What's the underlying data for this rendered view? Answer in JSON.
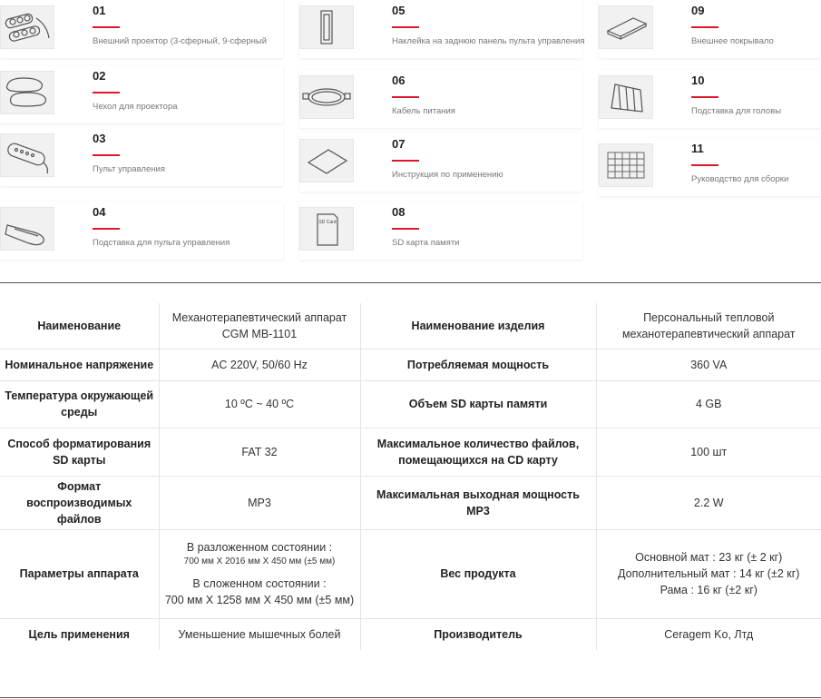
{
  "components": [
    {
      "num": "01",
      "label": "Внешний проектор (3-сферный, 9-сферный",
      "icon": "projector-icon"
    },
    {
      "num": "02",
      "label": "Чехол для проектора",
      "icon": "cover-icon"
    },
    {
      "num": "03",
      "label": "Пульт управления",
      "icon": "remote-icon"
    },
    {
      "num": "04",
      "label": "Подставка для пульта управления",
      "icon": "remote-stand-icon"
    },
    {
      "num": "05",
      "label": "Наклейка на заднюю панель пульта управления",
      "icon": "sticker-icon"
    },
    {
      "num": "06",
      "label": "Кабель питания",
      "icon": "cable-icon"
    },
    {
      "num": "07",
      "label": "Инструкция по применению",
      "icon": "manual-icon"
    },
    {
      "num": "08",
      "label": "SD карта памяти",
      "icon": "sd-card-icon",
      "thumb_text": "SD Card"
    },
    {
      "num": "09",
      "label": "Внешнее покрывало",
      "icon": "blanket-icon"
    },
    {
      "num": "10",
      "label": "Подставка для головы",
      "icon": "head-rest-icon"
    },
    {
      "num": "11",
      "label": "Руководство для сборки",
      "icon": "assembly-guide-icon"
    }
  ],
  "specs": {
    "r1": {
      "k1": "Наименование",
      "v1a": "Механотерапевтический аппарат",
      "v1b": "CGM MB-1101",
      "k2": "Наименование изделия",
      "v2a": "Персональный тепловой",
      "v2b": "механотерапевтический аппарат"
    },
    "r2": {
      "k1": "Номинальное напряжение",
      "v1": "AC 220V, 50/60 Hz",
      "k2": "Потребляемая мощность",
      "v2": "360 VA"
    },
    "r3": {
      "k1a": "Температура окружающей",
      "k1b": "среды",
      "v1": "10 ºC ~ 40 ºC",
      "k2": "Объем SD карты памяти",
      "v2": "4 GB"
    },
    "r4": {
      "k1a": "Способ форматирования",
      "k1b": "SD карты",
      "v1": "FAT 32",
      "k2a": "Максимальное количество файлов,",
      "k2b": "помещающихся на CD карту",
      "v2": "100 шт"
    },
    "r5": {
      "k1a": "Формат воспроизводимых",
      "k1b": "файлов",
      "v1": "MP3",
      "k2a": "Максимальная выходная мощность",
      "k2b": "MP3",
      "v2": "2.2 W"
    },
    "r6": {
      "k1": "Параметры аппарата",
      "v1a": "В разложенном состоянии :",
      "v1b": "700 мм X 2016 мм X 450 мм (±5 мм)",
      "v1c": "В сложенном состоянии :",
      "v1d": "700 мм X 1258 мм X 450 мм (±5 мм)",
      "k2": "Вес продукта",
      "v2a": "Основной мат : 23 кг (± 2 кг)",
      "v2b": "Дополнительный мат : 14 кг (±2 кг)",
      "v2c": "Рама : 16 кг (±2 кг)"
    },
    "r7": {
      "k1": "Цель применения",
      "v1": "Уменьшение мышечных болей",
      "k2": "Производитель",
      "v2": "Ceragem Ko, Лтд"
    }
  },
  "colors": {
    "accent": "#e0162b"
  }
}
